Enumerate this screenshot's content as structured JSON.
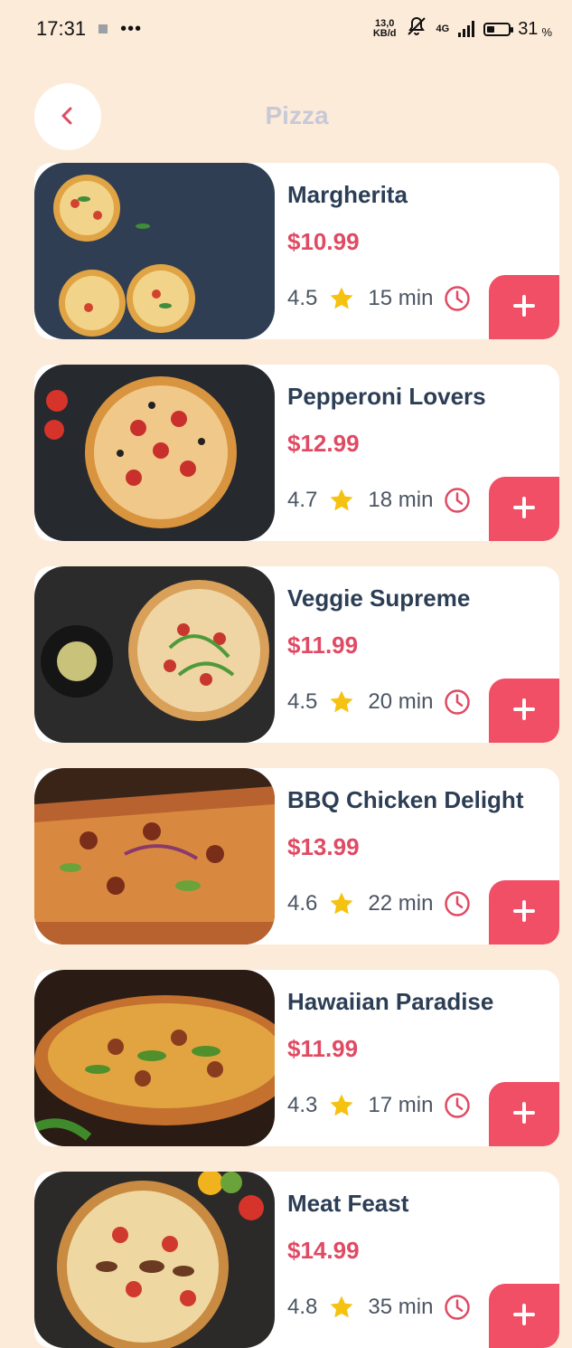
{
  "status_bar": {
    "time": "17:31",
    "dots": "•••",
    "net_speed_top": "13,0",
    "net_speed_bottom": "KB/d",
    "network": "4G",
    "battery": "31",
    "battery_unit": "%"
  },
  "header": {
    "title": "Pizza",
    "back_icon": "chevron-left-icon"
  },
  "colors": {
    "background": "#fdebd9",
    "accent": "#f04f66",
    "price": "#e04a63",
    "title": "#2c3e55",
    "star": "#f5c211"
  },
  "products": [
    {
      "name": "Margherita",
      "price": "$10.99",
      "rating": "4.5",
      "time": "15 min"
    },
    {
      "name": "Pepperoni Lovers",
      "price": "$12.99",
      "rating": "4.7",
      "time": "18 min"
    },
    {
      "name": "Veggie Supreme",
      "price": "$11.99",
      "rating": "4.5",
      "time": "20 min"
    },
    {
      "name": "BBQ Chicken Delight",
      "price": "$13.99",
      "rating": "4.6",
      "time": "22 min"
    },
    {
      "name": "Hawaiian Paradise",
      "price": "$11.99",
      "rating": "4.3",
      "time": "17 min"
    },
    {
      "name": "Meat Feast",
      "price": "$14.99",
      "rating": "4.8",
      "time": "35 min"
    }
  ]
}
